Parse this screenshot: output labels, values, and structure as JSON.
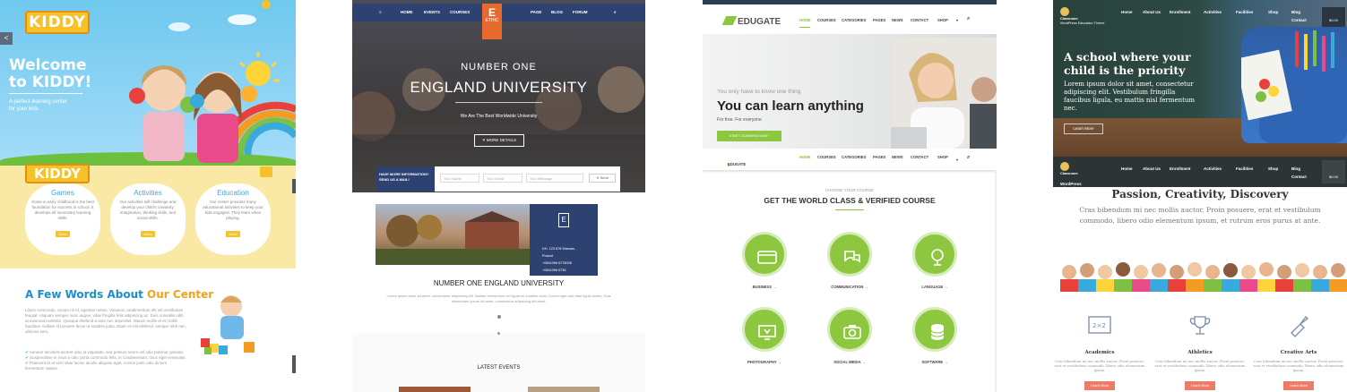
{
  "kiddy": {
    "logo": "KIDDY",
    "hero_title": "Welcome to KIDDY!",
    "hero_tagline": "A perfect learning center for your kids",
    "features": [
      {
        "title": "Games",
        "text": "Some in early childhood is the best foundation for success in school. It develops all necessary learning skills.",
        "button": "More"
      },
      {
        "title": "Activities",
        "text": "Our activities will challenge and develop your child's creativity, imagination, thinking skills, and social skills.",
        "button": "More"
      },
      {
        "title": "Education",
        "text": "Our center provides many educational activities to keep your kids engaged. They learn when playing.",
        "button": "More"
      }
    ],
    "about_title_a": "A Few Words About ",
    "about_title_b": "Our Center",
    "about_text": "Libero commodo, ornare mi id, egestas metus. Vivamus condimentum elit vel vestibulum feugiat. Aliquam semper nunc augue, vitae fringilla felis adipiscing ac. Duis convallis nibh at euismod molestie. Quisque eleifend a ante nec imperdiet. Mauris mollis et et mollis faucibus. Nullam id posuere lacus ut sodales justo. Etiam et elit eleifend, semper nibh nec, ultricies sem.",
    "about_list": [
      "Aenean tincidunt laoreet odio at vulputate, sed pretium lorem vel odio pulvinar gravida.",
      "Suspendisse in risus a odio porta commodo felis, in condimentum, risus eget venenatis.",
      "Praesent et at sem vitae luctus iaculis aliquam eget, cursus justo odio dictum fermentum sapien."
    ]
  },
  "university": {
    "nav_left": [
      "HOME",
      "EVENTS",
      "COURSES"
    ],
    "nav_right": [
      "PAGE",
      "BLOG",
      "FORUM"
    ],
    "badge_letter": "E",
    "badge_text": "ETHIC",
    "hero_line1": "NUMBER ONE",
    "hero_line2": "ENGLAND UNIVERSITY",
    "hero_sub": "We Are The Best Worldwide University",
    "more_button": "MORE DETAILS",
    "form_label": "HAVE MORE INFORMATION? SEND US A MAIL!",
    "form_fields": [
      "Your Name",
      "Your Email",
      "Your Message"
    ],
    "send_button": "Send",
    "info_lines": [
      "DH. 123 878 Warsaw, Poland",
      "+0841096 6778008",
      "+0841096 6736"
    ],
    "section_title": "NUMBER ONE ENGLAND UNIVERSITY",
    "section_text": "Lorem ipsum dolor sit amet, consectetur adipiscing elit. Nullam elementum vel ligula mi sodales dolor. Donec eget nisi vitae ligula luctus. Duis elementum ipsum sit amet, consectetur adipiscing elit amet.",
    "events_title": "LATEST EVENTS"
  },
  "edugate": {
    "logo": "EDUGATE",
    "nav": [
      "HOME",
      "COURSES",
      "CATEGORIES",
      "PAGES",
      "NEWS",
      "CONTACT",
      "SHOP"
    ],
    "hero_small": "You only have to know one thing",
    "hero_big": "You can learn anything",
    "hero_free": "For free. For everyone",
    "start_button": "START LEARNING NOW !",
    "choose": "CHOOSE YOUR COURSE",
    "section_title": "GET THE WORLD CLASS & VERIFIED COURSE",
    "courses": [
      "BUSINESS →",
      "COMMUNICATION →",
      "LANGUAGE →",
      "PHOTOGRAPHY →",
      "SOCIAL MEDIA →",
      "SOFTWARE →"
    ]
  },
  "classroom": {
    "logo_text": "Classroom",
    "logo_sub": "WordPress Education Theme",
    "nav": [
      "Home",
      "About Us",
      "Enrollment",
      "Activities",
      "Facilities",
      "Shop",
      "Blog",
      "Contact"
    ],
    "cart": "$0.00",
    "hero_title": "A school where your child is the priority",
    "hero_text": "Lorem ipsum dolor sit amet, consectetur adipiscing elit. Vestibulum fringilla faucibus ligula, eu mattis nisl fermentum nec.",
    "hero_button": "Learn More",
    "section_title": "Passion, Creativity, Discovery",
    "section_text": "Cras bibendum mi nec mollis auctor. Proin posuere, erat et vestibulum commodo, libero odio elementum ipsum, et rutrum eros purus at ante.",
    "features": [
      {
        "title": "Academics",
        "text": "Cras bibendum mi nec mollis auctor. Proin posuere, erat et vestibulum commodo, libero odio elementum ipsum.",
        "button": "Learn More"
      },
      {
        "title": "Athletics",
        "text": "Cras bibendum mi nec mollis auctor. Proin posuere, erat et vestibulum commodo, libero odio elementum ipsum.",
        "button": "Learn More"
      },
      {
        "title": "Creative Arts",
        "text": "Cras bibendum mi nec mollis auctor. Proin posuere, erat et vestibulum commodo, libero odio elementum ipsum.",
        "button": "Learn More"
      }
    ]
  },
  "colors": {
    "kiddy_yellow": "#f6c22b",
    "university_navy": "#2e4272",
    "edugate_green": "#8dc63f",
    "classroom_coral": "#ec7b6a"
  }
}
